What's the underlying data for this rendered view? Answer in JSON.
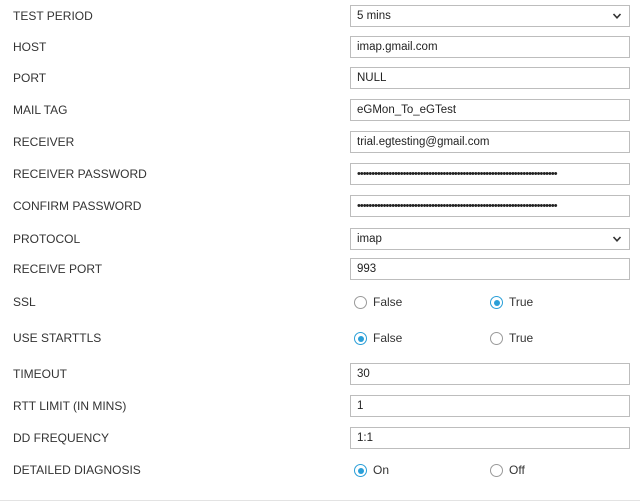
{
  "fields": [
    {
      "key": "test_period",
      "label": "TEST PERIOD",
      "type": "select",
      "value": "5 mins"
    },
    {
      "key": "host",
      "label": "HOST",
      "type": "text",
      "value": "imap.gmail.com"
    },
    {
      "key": "port",
      "label": "PORT",
      "type": "text",
      "value": "NULL"
    },
    {
      "key": "mail_tag",
      "label": "MAIL TAG",
      "type": "text",
      "value": "eGMon_To_eGTest"
    },
    {
      "key": "receiver",
      "label": "RECEIVER",
      "type": "text",
      "value": "trial.egtesting@gmail.com"
    },
    {
      "key": "receiver_password",
      "label": "RECEIVER PASSWORD",
      "type": "password",
      "value": "••••••••••••••••••••••••••••••••••••••••••••••••••••••••••••••••••••••"
    },
    {
      "key": "confirm_password",
      "label": "CONFIRM PASSWORD",
      "type": "password",
      "value": "••••••••••••••••••••••••••••••••••••••••••••••••••••••••••••••••••••••"
    },
    {
      "key": "protocol",
      "label": "PROTOCOL",
      "type": "select",
      "value": "imap"
    },
    {
      "key": "receive_port",
      "label": "RECEIVE PORT",
      "type": "text",
      "value": "993"
    },
    {
      "key": "ssl",
      "label": "SSL",
      "type": "radio",
      "options": [
        {
          "label": "False",
          "checked": false
        },
        {
          "label": "True",
          "checked": true
        }
      ]
    },
    {
      "key": "use_starttls",
      "label": "USE STARTTLS",
      "type": "radio",
      "options": [
        {
          "label": "False",
          "checked": true
        },
        {
          "label": "True",
          "checked": false
        }
      ]
    },
    {
      "key": "timeout",
      "label": "TIMEOUT",
      "type": "text",
      "value": "30"
    },
    {
      "key": "rtt_limit",
      "label": "RTT LIMIT (IN MINS)",
      "type": "text",
      "value": "1"
    },
    {
      "key": "dd_frequency",
      "label": "DD FREQUENCY",
      "type": "text",
      "value": "1:1"
    },
    {
      "key": "detailed_diagnosis",
      "label": "DETAILED DIAGNOSIS",
      "type": "radio",
      "options": [
        {
          "label": "On",
          "checked": true
        },
        {
          "label": "Off",
          "checked": false
        }
      ]
    }
  ],
  "icons": {
    "dropdown": "chevron-down-icon"
  },
  "colors": {
    "radio_selected": "#2a9fd8",
    "field_border": "#bdbdbd",
    "label_text": "#333333"
  }
}
